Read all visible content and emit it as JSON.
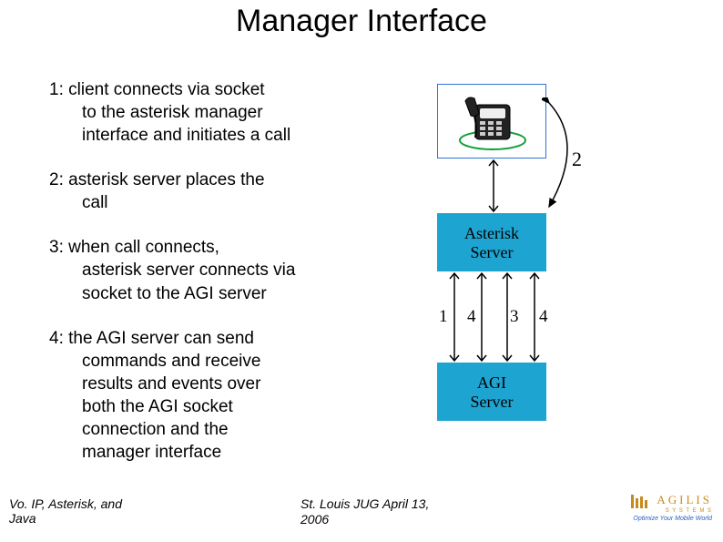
{
  "title": "Manager Interface",
  "steps": {
    "s1": {
      "first": "1: client connects via socket",
      "l2": "to the asterisk manager",
      "l3": "interface and initiates a call"
    },
    "s2": {
      "first": "2: asterisk server places the",
      "l2": "call"
    },
    "s3": {
      "first": "3: when call connects,",
      "l2": "asterisk server connects via",
      "l3": "socket to the AGI server"
    },
    "s4": {
      "first": "4: the AGI server can send",
      "l2": "commands and receive",
      "l3": "results and events over",
      "l4": "both the AGI socket",
      "l5": "connection and the",
      "l6": "manager interface"
    }
  },
  "diagram": {
    "label2": "2",
    "asterisk_l1": "Asterisk",
    "asterisk_l2": "Server",
    "agi_l1": "AGI",
    "agi_l2": "Server",
    "n1": "1",
    "n4a": "4",
    "n3": "3",
    "n4b": "4"
  },
  "footer": {
    "left_l1": "Vo. IP, Asterisk, and",
    "left_l2": "Java",
    "mid": "St. Louis JUG",
    "year": "2006",
    "date": "April 13,"
  },
  "logo": {
    "word": "AGILIS",
    "systems": "S Y S T E M S",
    "tag": "Optimize Your Mobile World"
  }
}
